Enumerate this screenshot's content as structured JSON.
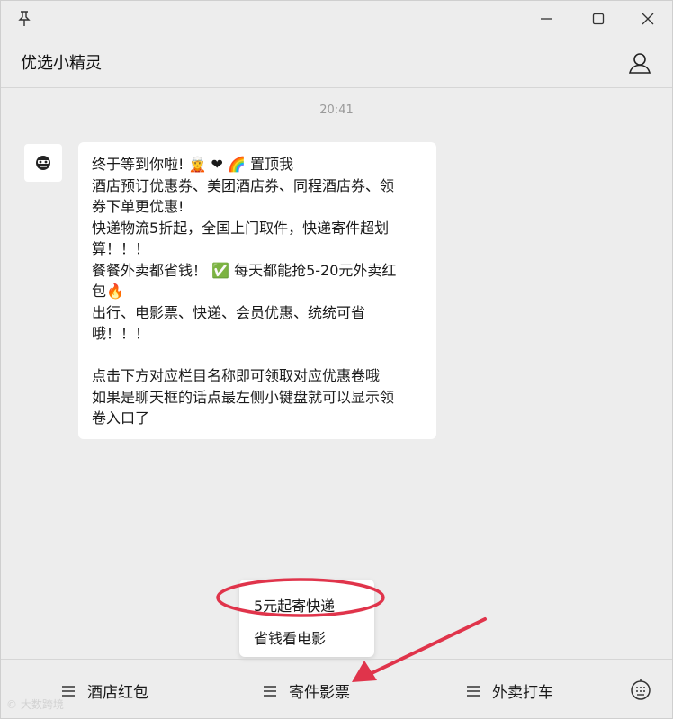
{
  "window": {
    "title": "优选小精灵"
  },
  "chat": {
    "time": "20:41",
    "message_lines": [
      "终于等到你啦! 🧝 ❤ 🌈 置顶我",
      "酒店预订优惠券、美团酒店券、同程酒店券、领",
      "券下单更优惠!",
      "快递物流5折起，全国上门取件，快递寄件超划",
      "算！！！",
      "餐餐外卖都省钱！ ✅ 每天都能抢5-20元外卖红",
      "包🔥",
      "出行、电影票、快递、会员优惠、统统可省",
      "哦！！！",
      "",
      "点击下方对应栏目名称即可领取对应优惠卷哦",
      "如果是聊天框的话点最左侧小键盘就可以显示领",
      "卷入口了"
    ]
  },
  "popup": {
    "items": [
      "5元起寄快递",
      "省钱看电影"
    ]
  },
  "bottom_menu": {
    "items": [
      "酒店红包",
      "寄件影票",
      "外卖打车"
    ]
  },
  "watermark": "© 大数跨境",
  "colors": {
    "highlight": "#e0344b",
    "arrow": "#e0344b",
    "background": "#ededed"
  },
  "icons": [
    "pin-icon",
    "minimize-icon",
    "maximize-icon",
    "close-icon",
    "profile-icon",
    "menu-icon",
    "keyboard-icon"
  ]
}
